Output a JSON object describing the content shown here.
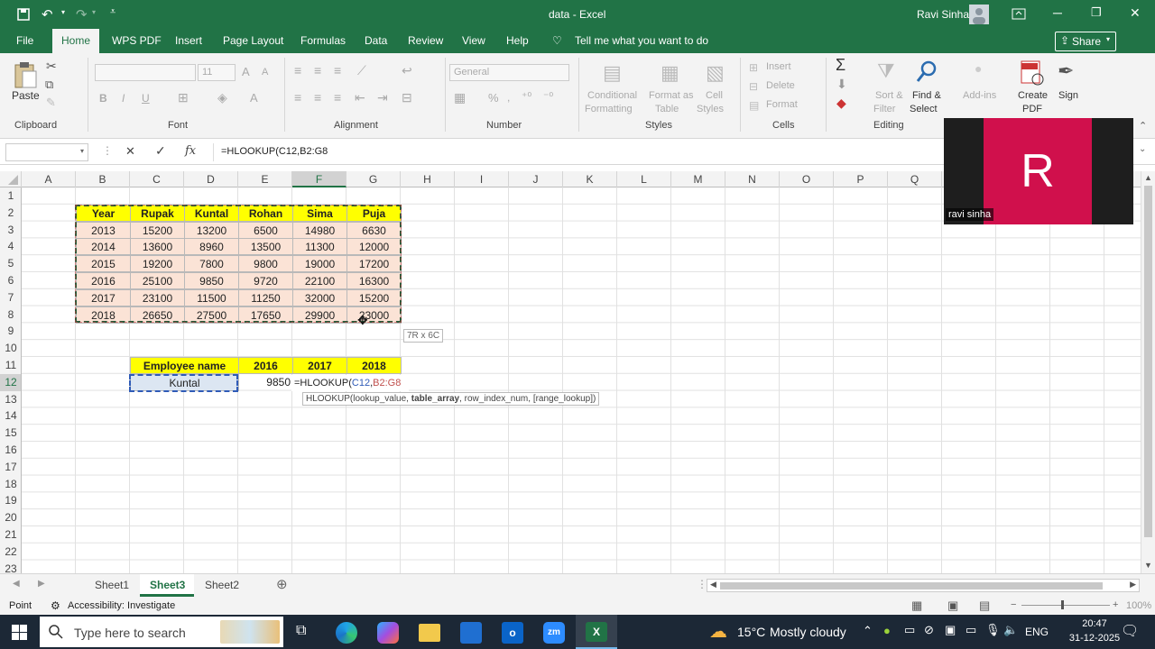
{
  "title_bar": {
    "doc_title": "data - Excel",
    "user_name": "Ravi Sinha"
  },
  "menu_tabs": [
    "File",
    "Home",
    "WPS PDF",
    "Insert",
    "Page Layout",
    "Formulas",
    "Data",
    "Review",
    "View",
    "Help"
  ],
  "tell_me": "Tell me what you want to do",
  "share_label": "Share",
  "ribbon": {
    "paste": "Paste",
    "clipboard": "Clipboard",
    "font": "Font",
    "font_size": "11",
    "alignment": "Alignment",
    "number_format": "General",
    "number": "Number",
    "cond_fmt": "Conditional",
    "cond_fmt2": "Formatting",
    "fmt_table": "Format as",
    "fmt_table2": "Table",
    "cell_styles": "Cell",
    "cell_styles2": "Styles",
    "styles": "Styles",
    "insert": "Insert",
    "delete": "Delete",
    "format": "Format",
    "cells": "Cells",
    "sort": "Sort &",
    "sort2": "Filter",
    "find": "Find &",
    "find2": "Select",
    "editing": "Editing",
    "addins": "Add-ins",
    "create_pdf": "Create",
    "create_pdf2": "PDF",
    "sign": "Sign"
  },
  "formula_bar": {
    "formula": "=HLOOKUP(C12,B2:G8"
  },
  "columns": [
    "A",
    "B",
    "C",
    "D",
    "E",
    "F",
    "G",
    "H",
    "I",
    "J",
    "K",
    "L",
    "M",
    "N",
    "O",
    "P",
    "Q"
  ],
  "rows": [
    "1",
    "2",
    "3",
    "4",
    "5",
    "6",
    "7",
    "8",
    "9",
    "10",
    "11",
    "12",
    "13",
    "14",
    "15",
    "16",
    "17",
    "18",
    "19",
    "20",
    "21",
    "22",
    "23"
  ],
  "table": {
    "header": [
      "Year",
      "Rupak",
      "Kuntal",
      "Rohan",
      "Sima",
      "Puja"
    ],
    "rows": [
      [
        "2013",
        "15200",
        "13200",
        "6500",
        "14980",
        "6630"
      ],
      [
        "2014",
        "13600",
        "8960",
        "13500",
        "11300",
        "12000"
      ],
      [
        "2015",
        "19200",
        "7800",
        "9800",
        "19000",
        "17200"
      ],
      [
        "2016",
        "25100",
        "9850",
        "9720",
        "22100",
        "16300"
      ],
      [
        "2017",
        "23100",
        "11500",
        "11250",
        "32000",
        "15200"
      ],
      [
        "2018",
        "26650",
        "27500",
        "17650",
        "29900",
        "23000"
      ]
    ]
  },
  "lookup": {
    "header": [
      "Employee name",
      "2016",
      "2017",
      "2018"
    ],
    "name": "Kuntal",
    "val_2016": "9850",
    "edit_prefix": "=HLOOKUP(",
    "edit_ref1": "C12",
    "edit_comma": ",",
    "edit_ref2": "B2:G8"
  },
  "selection_tip": "7R x 6C",
  "hint": {
    "fn": "HLOOKUP(",
    "a1": "lookup_value, ",
    "a2": "table_array",
    "a3": ", row_index_num, [range_lookup])"
  },
  "video": {
    "initial": "R",
    "name": "ravi sinha"
  },
  "sheets": [
    "Sheet1",
    "Sheet3",
    "Sheet2"
  ],
  "active_sheet": "Sheet3",
  "status": {
    "mode": "Point",
    "accessibility": "Accessibility: Investigate",
    "zoom": "100%"
  },
  "taskbar": {
    "search": "Type here to search",
    "weather_temp": "15°C",
    "weather_text": "Mostly cloudy",
    "lang": "ENG",
    "time": "20:47",
    "date": "31-12-2025"
  },
  "colors": {
    "excel_green": "#217346",
    "table_header": "#ffff00",
    "table_cell": "#fbe3d6",
    "video_red": "#d0104c"
  }
}
